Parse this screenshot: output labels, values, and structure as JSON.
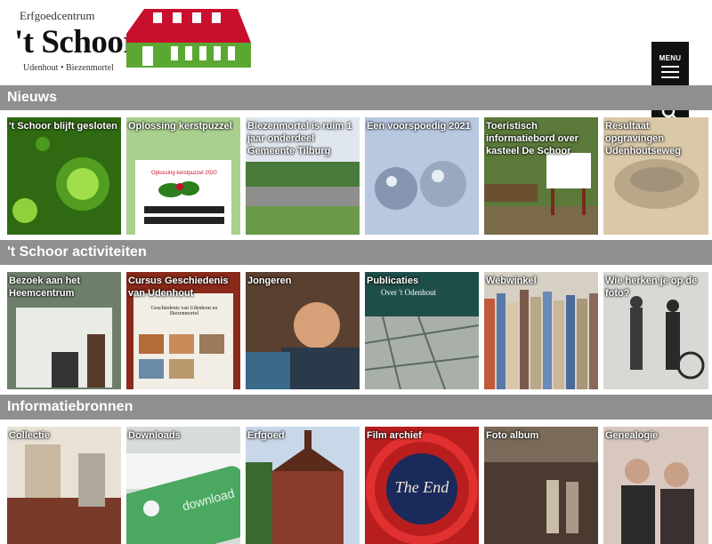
{
  "header": {
    "logo_top": "Erfgoedcentrum",
    "logo_main": "'t Schoor",
    "logo_sub": "Udenhout • Biezenmortel",
    "menu_label": "MENU"
  },
  "sections": [
    {
      "title": "Nieuws",
      "tiles": [
        {
          "title": "'t Schoor blijft gesloten"
        },
        {
          "title": "Oplossing kerstpuzzel"
        },
        {
          "title": "Biezenmortel is ruim 1 jaar onderdeel Gemeente Tilburg"
        },
        {
          "title": "Een voorspoedig 2021"
        },
        {
          "title": "Toeristisch informatiebord over kasteel De Schoor"
        },
        {
          "title": "Resultaat opgravingen Udenhoutseweg"
        }
      ]
    },
    {
      "title": "'t Schoor activiteiten",
      "tiles": [
        {
          "title": "Bezoek aan het Heemcentrum"
        },
        {
          "title": "Cursus Geschiedenis van Udenhout"
        },
        {
          "title": "Jongeren"
        },
        {
          "title": "Publicaties"
        },
        {
          "title": "Webwinkel"
        },
        {
          "title": "Wie herken je op de foto?"
        }
      ]
    },
    {
      "title": "Informatiebronnen",
      "tiles": [
        {
          "title": "Collectie"
        },
        {
          "title": "Downloads"
        },
        {
          "title": "Erfgoed"
        },
        {
          "title": "Film archief"
        },
        {
          "title": "Foto album"
        },
        {
          "title": "Genealogie"
        }
      ]
    }
  ],
  "tile_texts": {
    "puzzle_caption": "Oplossing kerstpuzzel 2020",
    "publication_title": "Over 't Odenhout",
    "book_title": "Geschiedenis van Udenhout en Biezenmortel",
    "download_label": "download",
    "film_end": "The End"
  },
  "colors": {
    "section_bar": "#8f8f8f",
    "logo_red": "#c8102e",
    "logo_green": "#5aa832"
  }
}
